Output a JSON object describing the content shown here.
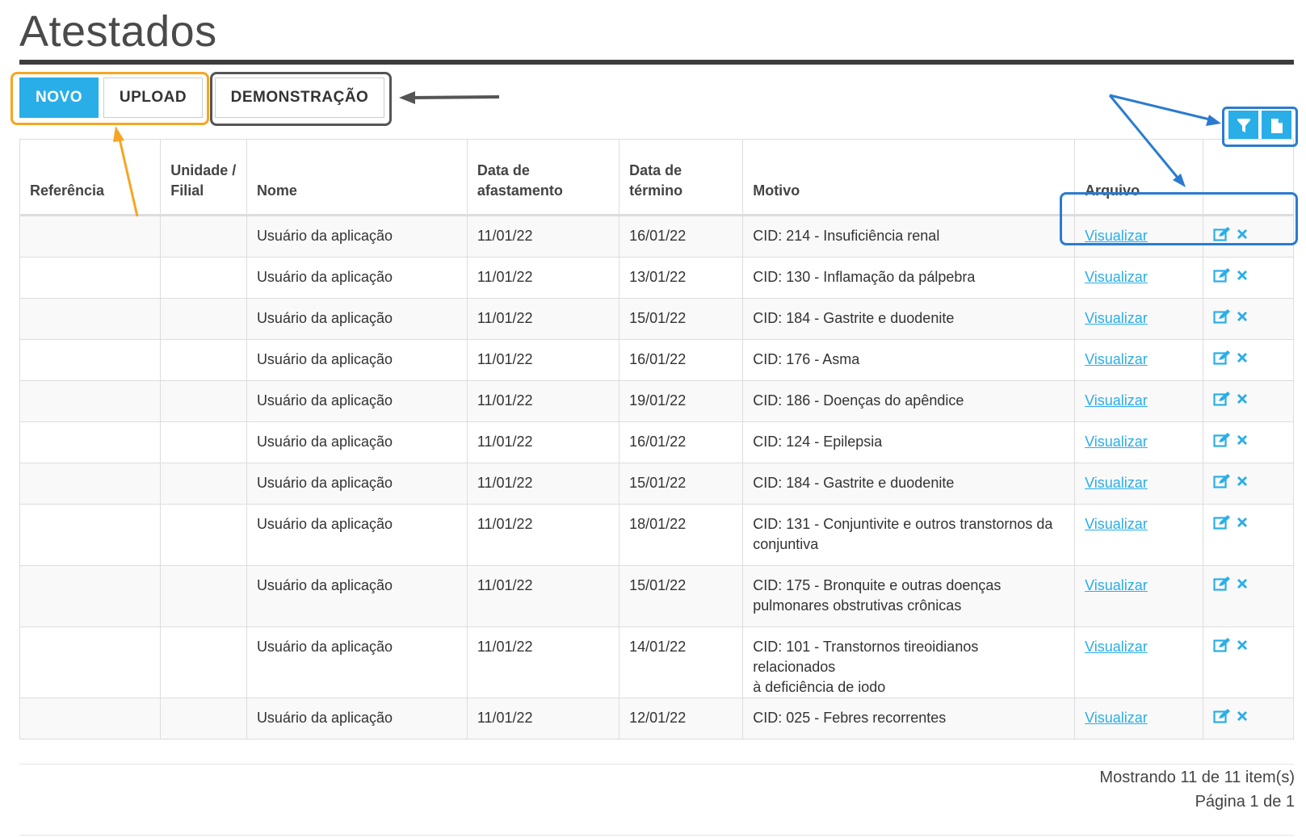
{
  "page": {
    "title": "Atestados"
  },
  "toolbar": {
    "novo_label": "NOVO",
    "upload_label": "UPLOAD",
    "demo_label": "DEMONSTRAÇÃO",
    "filter_icon": "filter-icon",
    "export_icon": "document-icon"
  },
  "table": {
    "headers": {
      "referencia": "Referência",
      "unidade": [
        "Unidade /",
        "Filial"
      ],
      "nome": "Nome",
      "afastamento": [
        "Data de",
        "afastamento"
      ],
      "termino": [
        "Data de",
        "término"
      ],
      "motivo": "Motivo",
      "arquivo": "Arquivo"
    },
    "rows": [
      {
        "referencia": "",
        "unidade": "",
        "nome": "Usuário da aplicação",
        "afastamento": "11/01/22",
        "termino": "16/01/22",
        "motivo": [
          "CID: 214 - Insuficiência renal"
        ],
        "arquivo": "Visualizar"
      },
      {
        "referencia": "",
        "unidade": "",
        "nome": "Usuário da aplicação",
        "afastamento": "11/01/22",
        "termino": "13/01/22",
        "motivo": [
          "CID: 130 - Inflamação da pálpebra"
        ],
        "arquivo": "Visualizar"
      },
      {
        "referencia": "",
        "unidade": "",
        "nome": "Usuário da aplicação",
        "afastamento": "11/01/22",
        "termino": "15/01/22",
        "motivo": [
          "CID: 184 - Gastrite e duodenite"
        ],
        "arquivo": "Visualizar"
      },
      {
        "referencia": "",
        "unidade": "",
        "nome": "Usuário da aplicação",
        "afastamento": "11/01/22",
        "termino": "16/01/22",
        "motivo": [
          "CID: 176 - Asma"
        ],
        "arquivo": "Visualizar"
      },
      {
        "referencia": "",
        "unidade": "",
        "nome": "Usuário da aplicação",
        "afastamento": "11/01/22",
        "termino": "19/01/22",
        "motivo": [
          "CID: 186 - Doenças do apêndice"
        ],
        "arquivo": "Visualizar"
      },
      {
        "referencia": "",
        "unidade": "",
        "nome": "Usuário da aplicação",
        "afastamento": "11/01/22",
        "termino": "16/01/22",
        "motivo": [
          "CID: 124 - Epilepsia"
        ],
        "arquivo": "Visualizar"
      },
      {
        "referencia": "",
        "unidade": "",
        "nome": "Usuário da aplicação",
        "afastamento": "11/01/22",
        "termino": "15/01/22",
        "motivo": [
          "CID: 184 - Gastrite e duodenite"
        ],
        "arquivo": "Visualizar"
      },
      {
        "referencia": "",
        "unidade": "",
        "nome": "Usuário da aplicação",
        "afastamento": "11/01/22",
        "termino": "18/01/22",
        "motivo": [
          "CID: 131 - Conjuntivite e outros transtornos da",
          "conjuntiva"
        ],
        "arquivo": "Visualizar"
      },
      {
        "referencia": "",
        "unidade": "",
        "nome": "Usuário da aplicação",
        "afastamento": "11/01/22",
        "termino": "15/01/22",
        "motivo": [
          "CID: 175 - Bronquite e outras doenças",
          "pulmonares obstrutivas crônicas"
        ],
        "arquivo": "Visualizar"
      },
      {
        "referencia": "",
        "unidade": "",
        "nome": "Usuário da aplicação",
        "afastamento": "11/01/22",
        "termino": "14/01/22",
        "motivo": [
          "CID: 101 - Transtornos tireoidianos relacionados",
          "à deficiência de iodo"
        ],
        "arquivo": "Visualizar"
      },
      {
        "referencia": "",
        "unidade": "",
        "nome": "Usuário da aplicação",
        "afastamento": "11/01/22",
        "termino": "12/01/22",
        "motivo": [
          "CID: 025 - Febres recorrentes"
        ],
        "arquivo": "Visualizar"
      }
    ],
    "row_action_icons": [
      "edit-icon",
      "delete-icon"
    ]
  },
  "footer": {
    "showing": "Mostrando 11 de 11 item(s)",
    "pagination": "Página 1 de 1"
  },
  "colors": {
    "accent": "#29aee8",
    "highlight_orange": "#f5a623",
    "highlight_gray": "#555555",
    "highlight_blue": "#2a7bd0",
    "title_rule": "#3d3d3d"
  }
}
